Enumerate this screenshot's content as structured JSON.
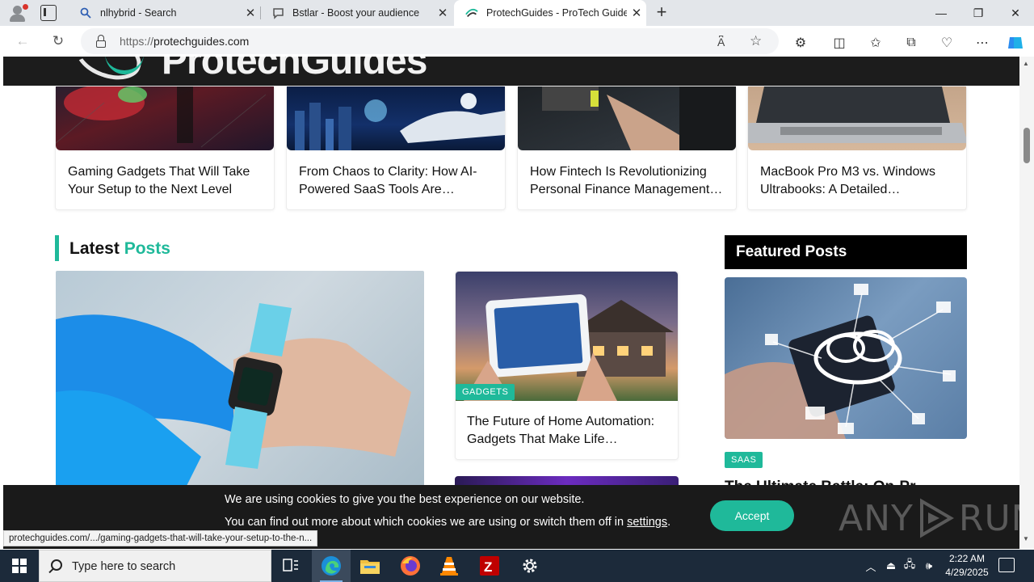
{
  "browser": {
    "tabs": [
      {
        "title": "nlhybrid - Search",
        "icon": "search-icon"
      },
      {
        "title": "Bstlar - Boost your audience",
        "icon": "chat-icon"
      },
      {
        "title": "ProtechGuides - ProTech Guides:",
        "icon": "protechguides-favicon"
      }
    ],
    "url_protocol": "https://",
    "url_host": "protechguides.com"
  },
  "site": {
    "logo_text": "ProtechGuides",
    "top_cards": [
      {
        "title": "Gaming Gadgets That Will Take Your Setup to the Next Level"
      },
      {
        "title": "From Chaos to Clarity: How AI-Powered SaaS Tools Are…"
      },
      {
        "title": "How Fintech Is Revolutionizing Personal Finance Management…"
      },
      {
        "title": "MacBook Pro M3 vs. Windows Ultrabooks: A Detailed…"
      }
    ],
    "latest": {
      "title_part1": "Latest",
      "title_part2": "Posts",
      "mid_card": {
        "category": "GADGETS",
        "title": "The Future of Home Automation: Gadgets That Make Life…"
      }
    },
    "featured": {
      "title": "Featured Posts",
      "category": "SAAS",
      "post_title_peek": "The Ultimate Battle: On-Pr"
    },
    "cookie": {
      "line1": "We are using cookies to give you the best experience on our website.",
      "line2_prefix": "You can find out more about which cookies we are using or switch them off in ",
      "settings_link": "settings",
      "line2_suffix": ".",
      "accept_label": "Accept"
    },
    "watermark": "ANY RUN"
  },
  "status_url": "protechguides.com/.../gaming-gadgets-that-will-take-your-setup-to-the-n...",
  "taskbar": {
    "search_placeholder": "Type here to search",
    "time": "2:22 AM",
    "date": "4/29/2025"
  },
  "colors": {
    "accent": "#1fb99a",
    "header_bg": "#1c1c1c",
    "taskbar_bg": "#1c2a3a"
  }
}
